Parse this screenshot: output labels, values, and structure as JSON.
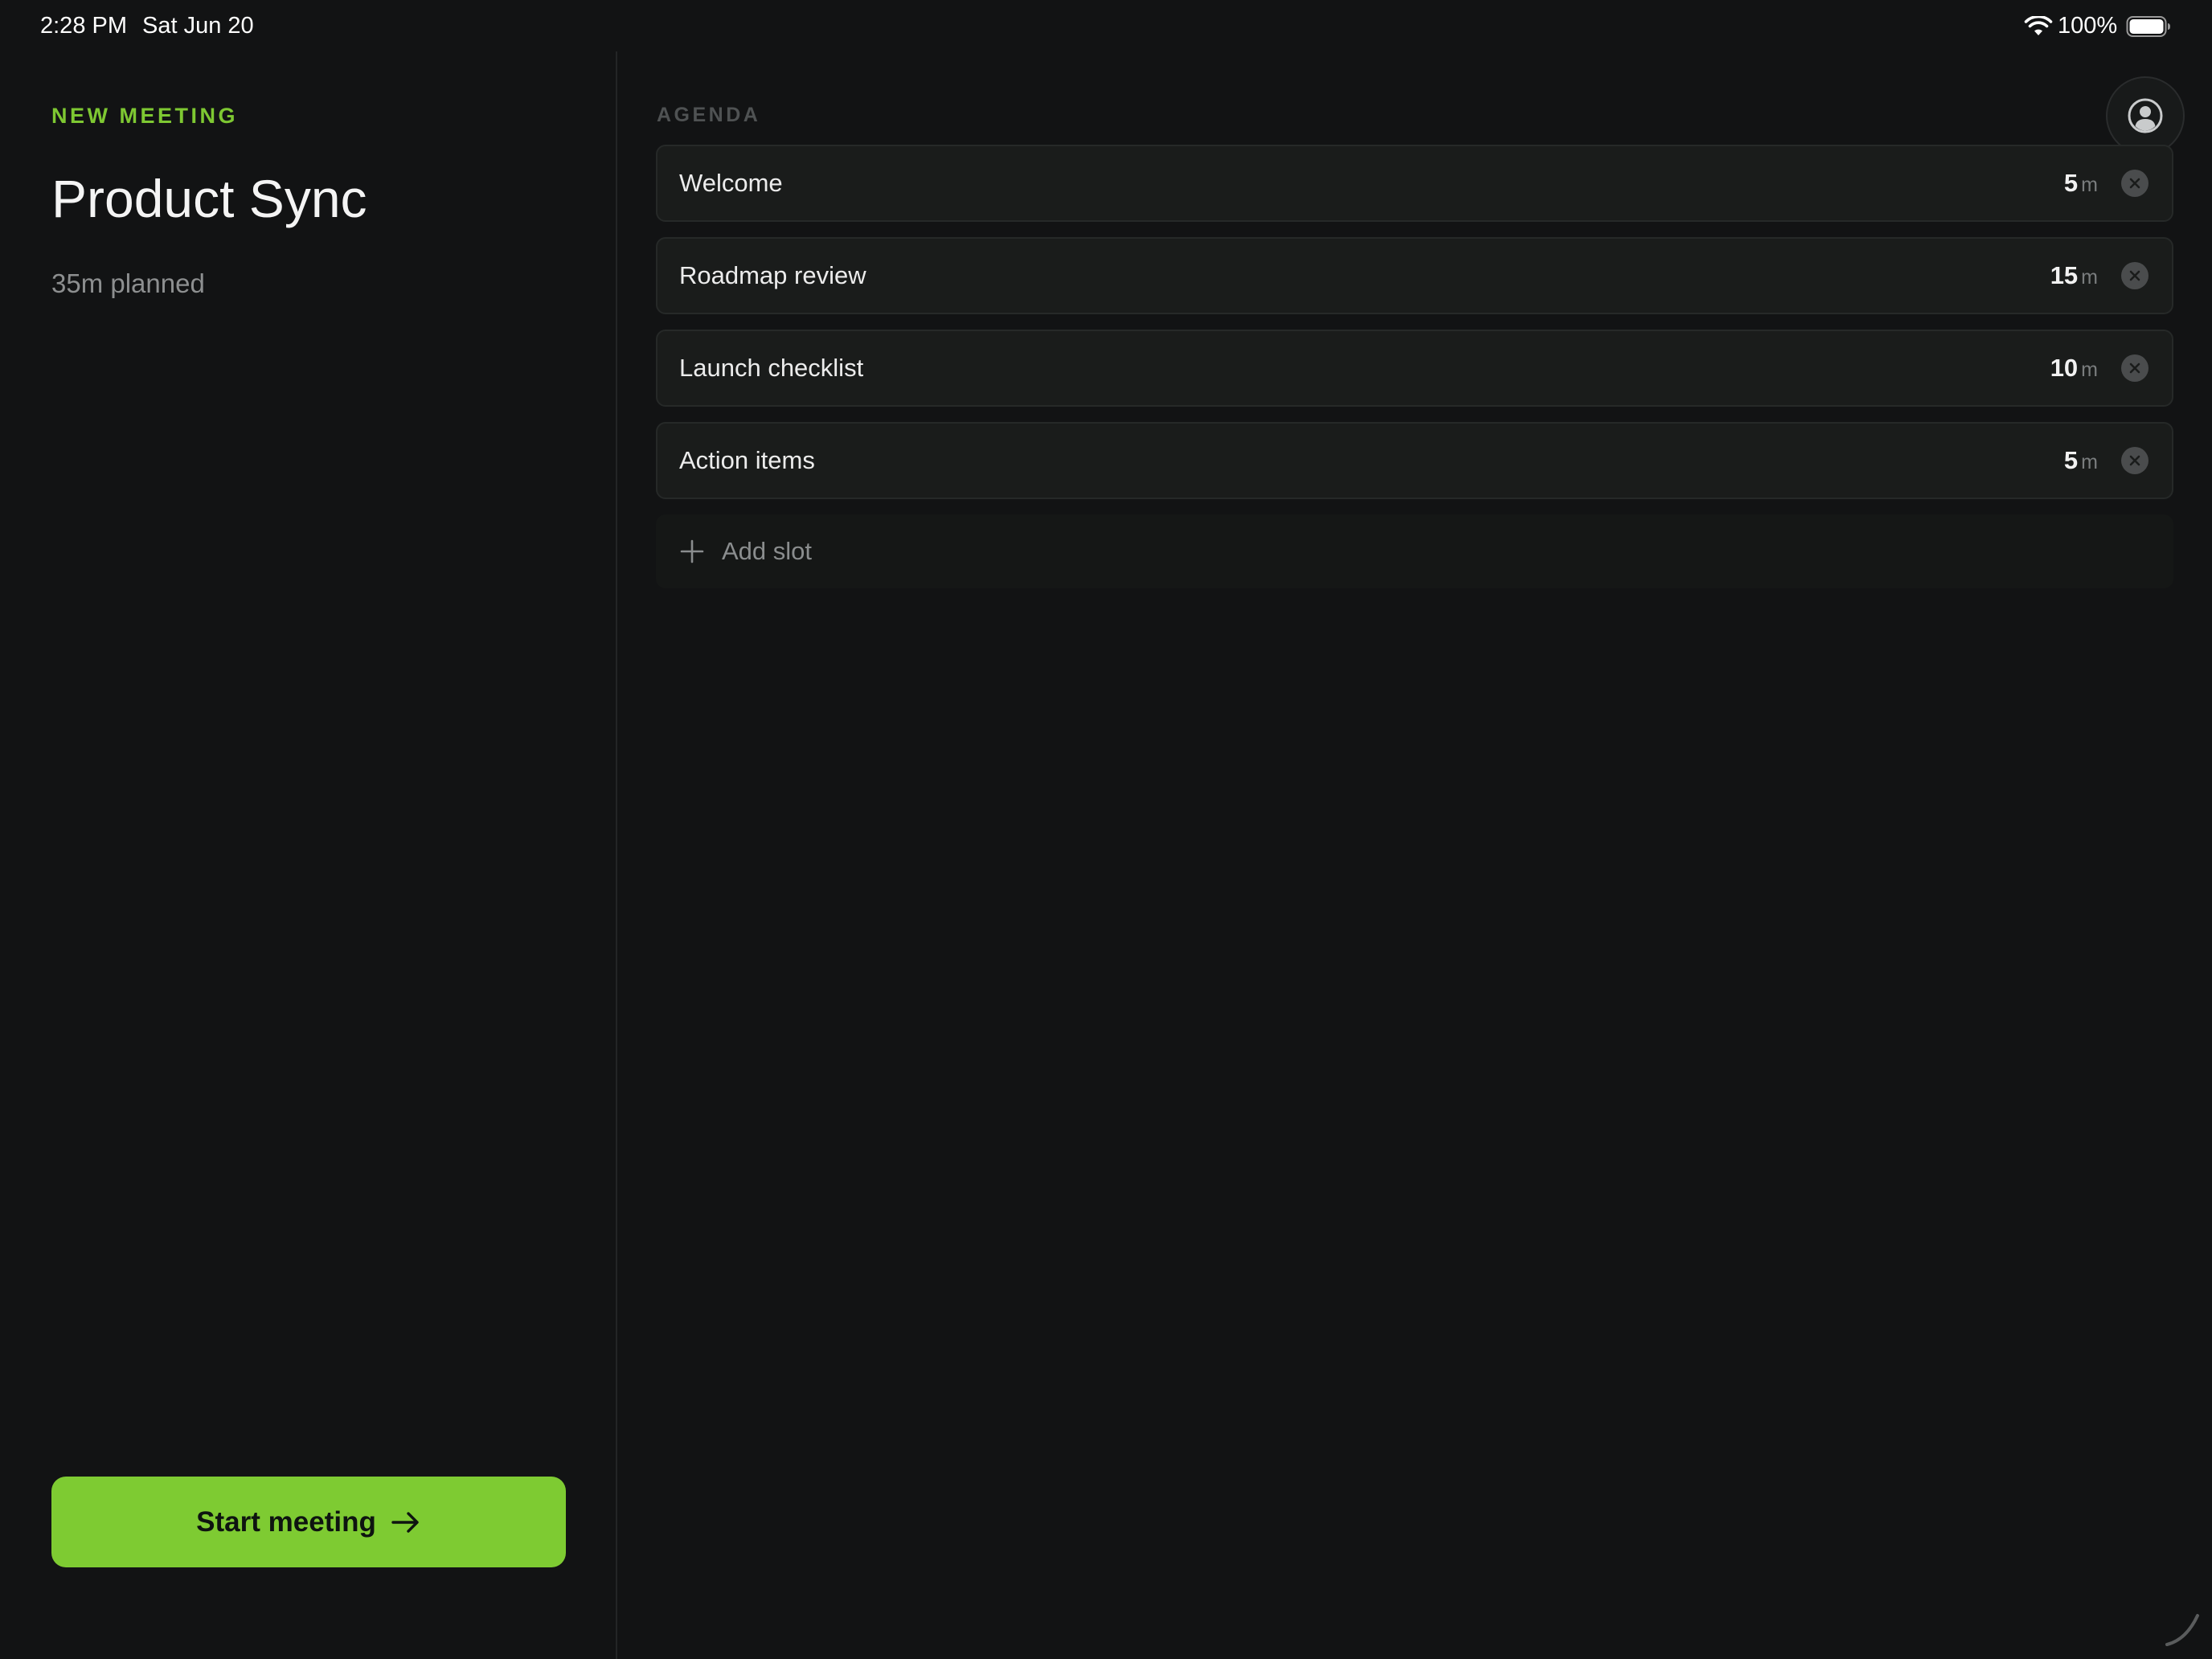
{
  "status_bar": {
    "time": "2:28 PM",
    "date": "Sat Jun 20",
    "battery_percent": "100%",
    "wifi_icon": "wifi-icon",
    "battery_icon": "battery-icon",
    "battery_level": 1.0
  },
  "sidebar": {
    "eyebrow": "NEW MEETING",
    "title": "Product Sync",
    "planned": "35m planned",
    "start_button": {
      "label": "Start meeting",
      "icon": "arrow-right-icon"
    }
  },
  "agenda": {
    "section_label": "AGENDA",
    "profile_icon": "profile-icon",
    "items": [
      {
        "title": "Welcome",
        "minutes": "5",
        "unit": "m",
        "remove_icon": "close-circle-icon"
      },
      {
        "title": "Roadmap review",
        "minutes": "15",
        "unit": "m",
        "remove_icon": "close-circle-icon"
      },
      {
        "title": "Launch checklist",
        "minutes": "10",
        "unit": "m",
        "remove_icon": "close-circle-icon"
      },
      {
        "title": "Action items",
        "minutes": "5",
        "unit": "m",
        "remove_icon": "close-circle-icon"
      }
    ],
    "add_slot": {
      "label": "Add slot",
      "icon": "plus-icon"
    }
  },
  "colors": {
    "background": "#121314",
    "accent": "#7ecb32",
    "row_background": "#1a1c1b",
    "muted_text": "#8d8f90"
  }
}
